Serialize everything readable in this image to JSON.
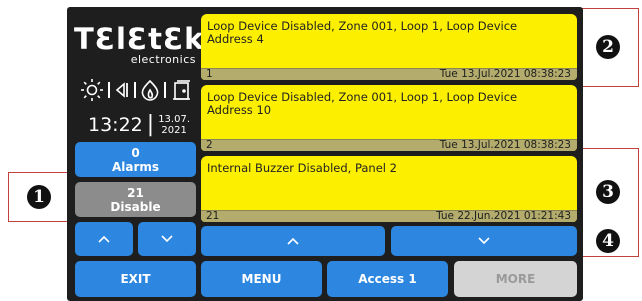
{
  "brand": {
    "name": "TƐlƐtƐk",
    "sub": "electronics"
  },
  "status_icons": [
    "sun-icon",
    "speaker-muted-icon",
    "flame-icon",
    "door-icon"
  ],
  "clock": {
    "time": "13:22",
    "sep": "|",
    "date_line1": "13.07.",
    "date_line2": "2021"
  },
  "counters": {
    "alarms": {
      "count": "0",
      "label": "Alarms"
    },
    "disable": {
      "count": "21",
      "label": "Disable"
    }
  },
  "left_nav": {
    "up": "^",
    "down": "v"
  },
  "messages": [
    {
      "text": "Loop Device Disabled, Zone 001, Loop 1, Loop Device Address 4",
      "num": "1",
      "timestamp": "Tue 13.Jul.2021 08:38:23"
    },
    {
      "text": "Loop Device Disabled, Zone 001, Loop 1, Loop Device Address 10",
      "num": "2",
      "timestamp": "Tue 13.Jul.2021 08:38:23"
    },
    {
      "text": "Internal Buzzer Disabled, Panel 2",
      "num": "21",
      "timestamp": "Tue 22.Jun.2021 01:21:43"
    }
  ],
  "list_nav": {
    "up": "^",
    "down": "v"
  },
  "bottom": {
    "exit": "EXIT",
    "menu": "MENU",
    "access": "Access 1",
    "more": "MORE"
  },
  "callouts": [
    "1",
    "2",
    "3",
    "4"
  ],
  "colors": {
    "panel": "#1e1e1e",
    "button_blue": "#2d87e0",
    "message_yellow": "#fcf000",
    "callout_line": "#c0413e"
  }
}
